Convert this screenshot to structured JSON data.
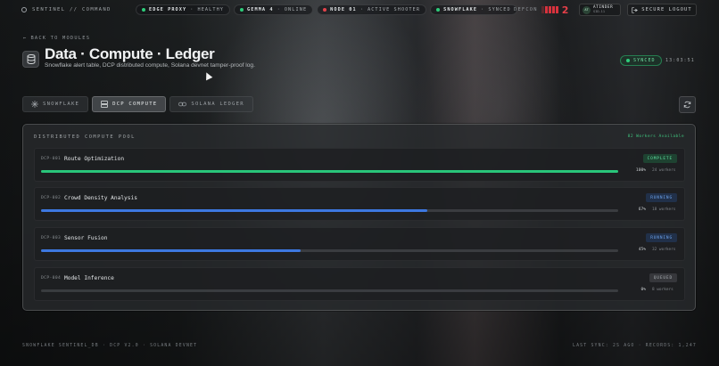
{
  "topbar": {
    "brand": "SENTINEL // COMMAND",
    "pills": [
      {
        "name": "EDGE PROXY",
        "status": "HEALTHY",
        "color": "green"
      },
      {
        "name": "GEMMA 4",
        "status": "ONLINE",
        "color": "green"
      },
      {
        "name": "NODE 01",
        "status": "ACTIVE SHOOTER",
        "color": "red"
      },
      {
        "name": "SNOWFLAKE",
        "status": "SYNCED",
        "color": "green"
      }
    ],
    "defcon_label": "DEFCON",
    "defcon_level": "2",
    "user_initials": "AT",
    "user_name": "ATINDER",
    "user_id": "SID-11",
    "logout_label": "SECURE LOGOUT"
  },
  "header": {
    "back_label": "BACK TO MODULES",
    "title": "Data · Compute · Ledger",
    "subtitle": "Snowflake alert table, DCP distributed compute, Solana devnet tamper-proof log.",
    "sync_status": "SYNCED",
    "timestamp": "13:03:51"
  },
  "tabs": [
    {
      "label": "SNOWFLAKE",
      "icon": "snowflake-icon",
      "active": false
    },
    {
      "label": "DCP COMPUTE",
      "icon": "server-icon",
      "active": true
    },
    {
      "label": "SOLANA LEDGER",
      "icon": "link-icon",
      "active": false
    }
  ],
  "pool": {
    "title": "DISTRIBUTED COMPUTE POOL",
    "available": "82 Workers Available",
    "jobs": [
      {
        "id": "DCP-001",
        "name": "Route Optimization",
        "status": "COMPLETE",
        "progress": 100,
        "progress_label": "100%",
        "workers": "24 workers"
      },
      {
        "id": "DCP-002",
        "name": "Crowd Density Analysis",
        "status": "RUNNING",
        "progress": 67,
        "progress_label": "67%",
        "workers": "18 workers"
      },
      {
        "id": "DCP-003",
        "name": "Sensor Fusion",
        "status": "RUNNING",
        "progress": 45,
        "progress_label": "45%",
        "workers": "32 workers"
      },
      {
        "id": "DCP-004",
        "name": "Model Inference",
        "status": "QUEUED",
        "progress": 0,
        "progress_label": "0%",
        "workers": "8 workers"
      }
    ]
  },
  "footer": {
    "left": "SNOWFLAKE SENTINEL_DB · DCP V2.0 · SOLANA DEVNET",
    "right": "LAST SYNC: 2S AGO · RECORDS: 1,247"
  },
  "colors": {
    "green": "#29c57a",
    "blue": "#3d78e0",
    "red": "#e3434b"
  }
}
